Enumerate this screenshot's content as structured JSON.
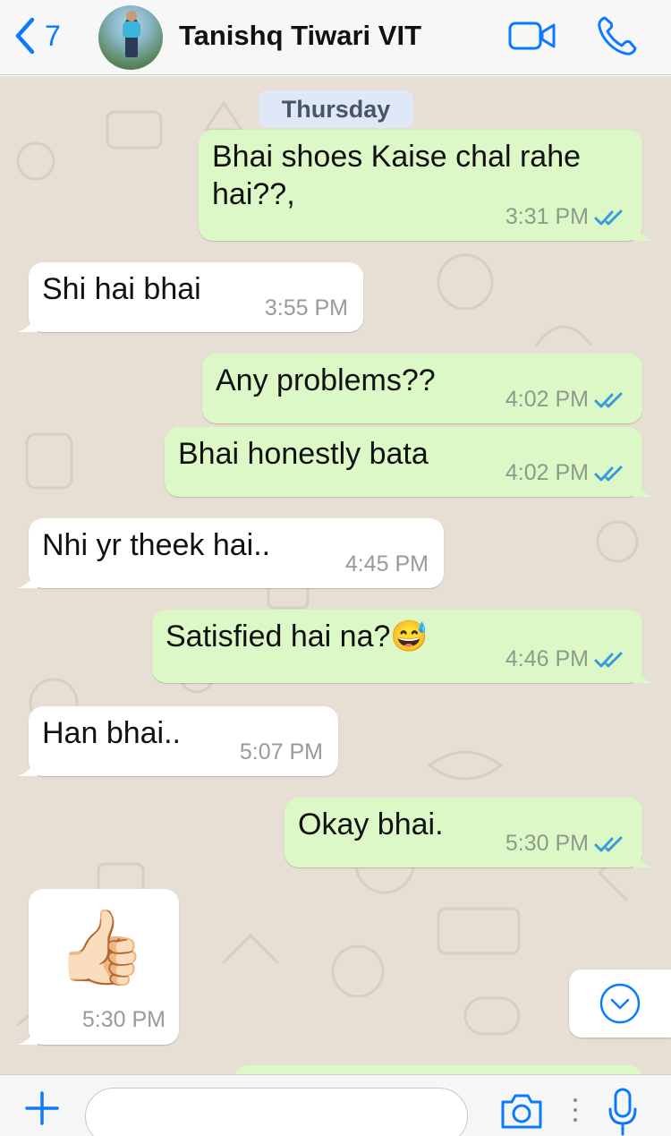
{
  "colors": {
    "accent": "#0a7aff",
    "outgoing_bubble": "#dcf8c6",
    "incoming_bubble": "#ffffff",
    "chat_background": "#e7ded4",
    "read_ticks": "#3a9bdc"
  },
  "header": {
    "back_count": "7",
    "contact_name": "Tanishq Tiwari VIT",
    "icons": [
      "chevron-left-icon",
      "video-call-icon",
      "phone-icon"
    ]
  },
  "chat": {
    "day_label": "Thursday",
    "messages": [
      {
        "direction": "out",
        "text": "Bhai shoes Kaise chal rahe hai??,",
        "time": "3:31 PM",
        "read": true
      },
      {
        "direction": "in",
        "text": "Shi hai bhai",
        "time": "3:55 PM"
      },
      {
        "direction": "out",
        "text": "Any problems??",
        "time": "4:02 PM",
        "read": true
      },
      {
        "direction": "out",
        "text": "Bhai honestly bata",
        "time": "4:02 PM",
        "read": true
      },
      {
        "direction": "in",
        "text": "Nhi yr theek hai..",
        "time": "4:45 PM"
      },
      {
        "direction": "out",
        "text": "Satisfied hai na?😅",
        "time": "4:46 PM",
        "read": true
      },
      {
        "direction": "in",
        "text": "Han bhai..",
        "time": "5:07 PM"
      },
      {
        "direction": "out",
        "text": "Okay bhai.",
        "time": "5:30 PM",
        "read": true
      },
      {
        "direction": "in",
        "emoji": "👍🏻",
        "time": "5:30 PM"
      }
    ]
  },
  "input_bar": {
    "placeholder": "",
    "icons": [
      "plus-icon",
      "camera-icon",
      "microphone-icon"
    ]
  }
}
